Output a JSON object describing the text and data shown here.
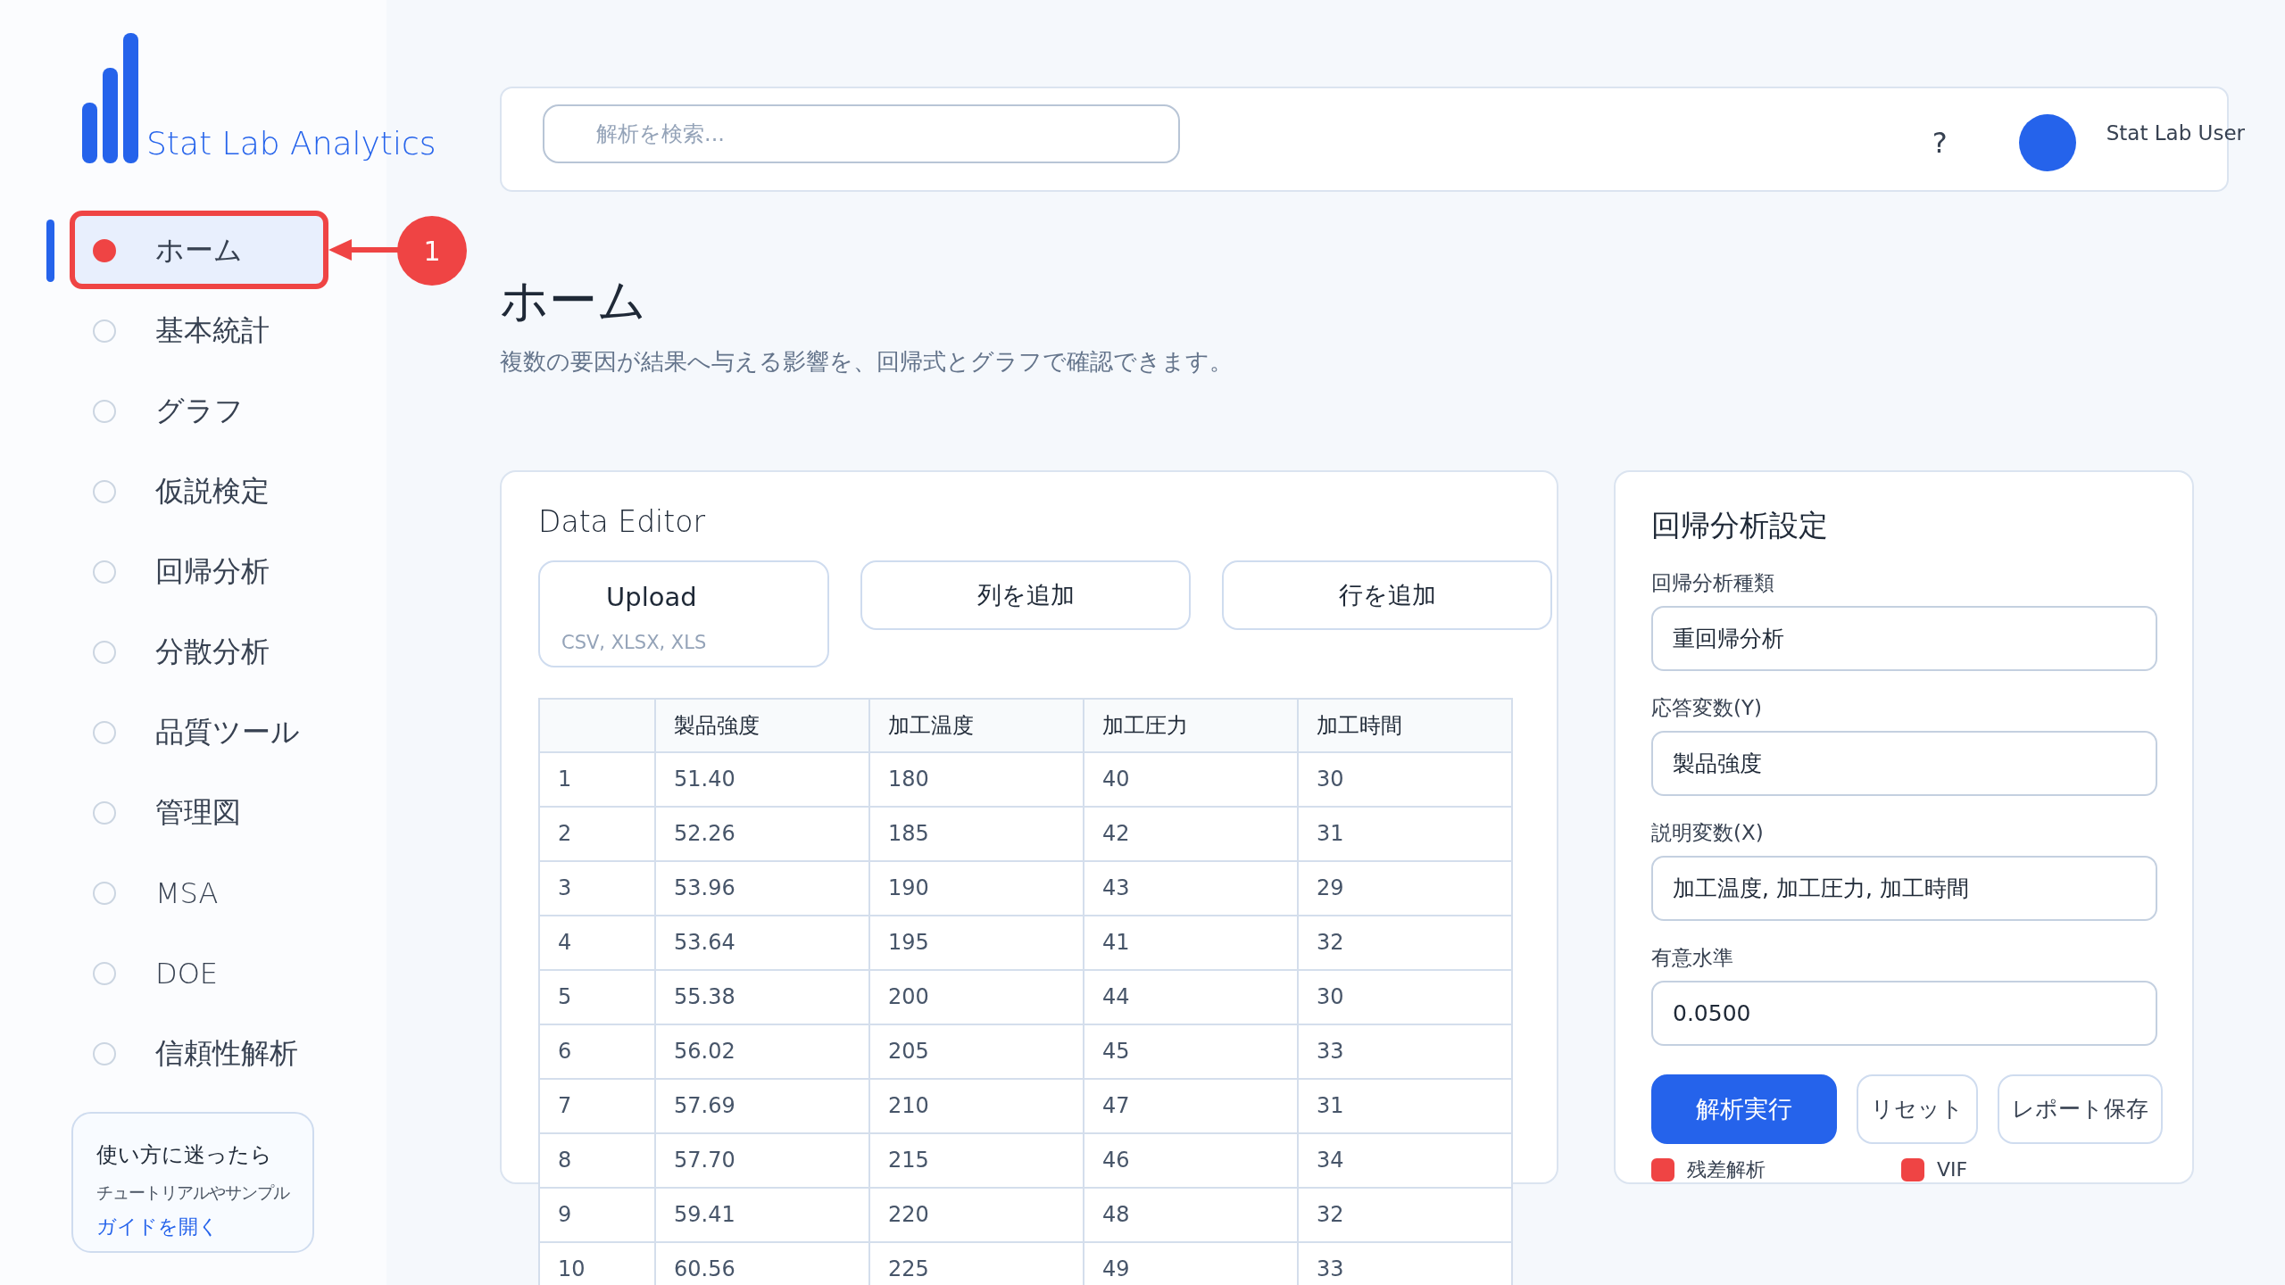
{
  "app": {
    "name": "Stat Lab Analytics"
  },
  "nav": [
    {
      "label": "ホーム",
      "selected": true
    },
    {
      "label": "基本統計",
      "selected": false
    },
    {
      "label": "グラフ",
      "selected": false
    },
    {
      "label": "仮説検定",
      "selected": false
    },
    {
      "label": "回帰分析",
      "selected": false
    },
    {
      "label": "分散分析",
      "selected": false
    },
    {
      "label": "品質ツール",
      "selected": false
    },
    {
      "label": "管理図",
      "selected": false
    },
    {
      "label": "MSA",
      "selected": false
    },
    {
      "label": "DOE",
      "selected": false
    },
    {
      "label": "信頼性解析",
      "selected": false
    }
  ],
  "help": {
    "title": "使い方に迷ったら",
    "text": "チュートリアルやサンプル",
    "link": "ガイドを開く"
  },
  "header": {
    "search_placeholder": "解析を検索...",
    "help": "?",
    "user": "Stat Lab User"
  },
  "page": {
    "title": "ホーム",
    "subtitle": "複数の要因が結果へ与える影響を、回帰式とグラフで確認できます。"
  },
  "data_editor": {
    "title": "Data Editor",
    "upload": {
      "label": "Upload",
      "formats": "CSV, XLSX, XLS"
    },
    "buttons": [
      "列を追加",
      "行を追加"
    ],
    "columns": [
      "",
      "製品強度",
      "加工温度",
      "加工圧力",
      "加工時間"
    ],
    "rows": [
      [
        "1",
        "51.40",
        "180",
        "40",
        "30"
      ],
      [
        "2",
        "52.26",
        "185",
        "42",
        "31"
      ],
      [
        "3",
        "53.96",
        "190",
        "43",
        "29"
      ],
      [
        "4",
        "53.64",
        "195",
        "41",
        "32"
      ],
      [
        "5",
        "55.38",
        "200",
        "44",
        "30"
      ],
      [
        "6",
        "56.02",
        "205",
        "45",
        "33"
      ],
      [
        "7",
        "57.69",
        "210",
        "47",
        "31"
      ],
      [
        "8",
        "57.70",
        "215",
        "46",
        "34"
      ],
      [
        "9",
        "59.41",
        "220",
        "48",
        "32"
      ],
      [
        "10",
        "60.56",
        "225",
        "49",
        "33"
      ]
    ]
  },
  "settings": {
    "title": "回帰分析設定",
    "fields": [
      {
        "label": "回帰分析種類",
        "value": "重回帰分析"
      },
      {
        "label": "応答変数(Y)",
        "value": "製品強度"
      },
      {
        "label": "説明変数(X)",
        "value": "加工温度, 加工圧力, 加工時間"
      },
      {
        "label": "有意水準",
        "value": "0.0500"
      }
    ],
    "buttons": [
      {
        "label": "解析実行",
        "primary": true
      },
      {
        "label": "リセット",
        "primary": false
      },
      {
        "label": "レポート保存",
        "primary": false
      }
    ],
    "options": [
      {
        "label": "残差解析",
        "checked": true
      },
      {
        "label": "VIF",
        "checked": true
      }
    ]
  },
  "annotation": {
    "number": "1"
  }
}
